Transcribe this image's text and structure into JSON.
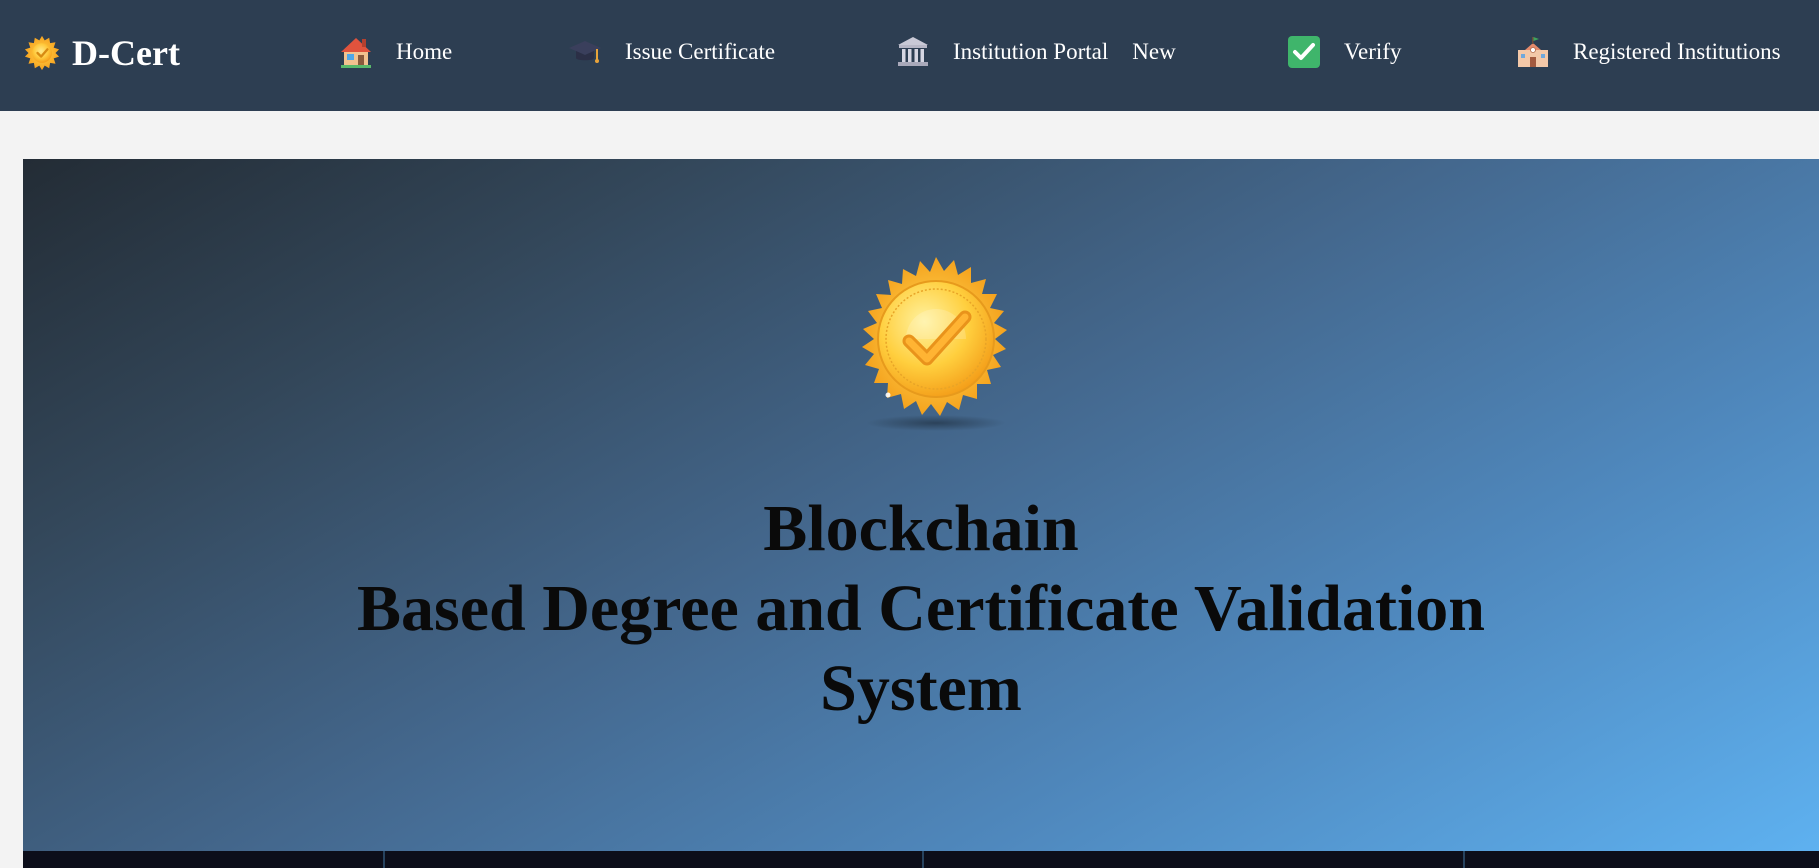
{
  "brand": {
    "name": "D-Cert",
    "icon": "gold-seal-icon"
  },
  "nav": {
    "items": [
      {
        "label": "Home",
        "icon": "house-icon"
      },
      {
        "label": "Issue Certificate",
        "icon": "graduation-cap-icon"
      },
      {
        "label": "Institution Portal",
        "badge": "New",
        "icon": "classical-building-icon"
      },
      {
        "label": "Verify",
        "icon": "check-mark-icon"
      },
      {
        "label": "Registered Institutions",
        "icon": "school-icon"
      }
    ]
  },
  "hero": {
    "title_line1": "Blockchain",
    "title_line2": "Based Degree and Certificate Validation",
    "title_line3": "System",
    "icon": "gold-seal-checkmark-icon"
  },
  "colors": {
    "navbar": "#2d3e52",
    "page_background": "#f3f3f3",
    "hero_gradient_start": "#232c35",
    "hero_gradient_end": "#5eb1f0",
    "title_text": "#0a0a0a"
  }
}
